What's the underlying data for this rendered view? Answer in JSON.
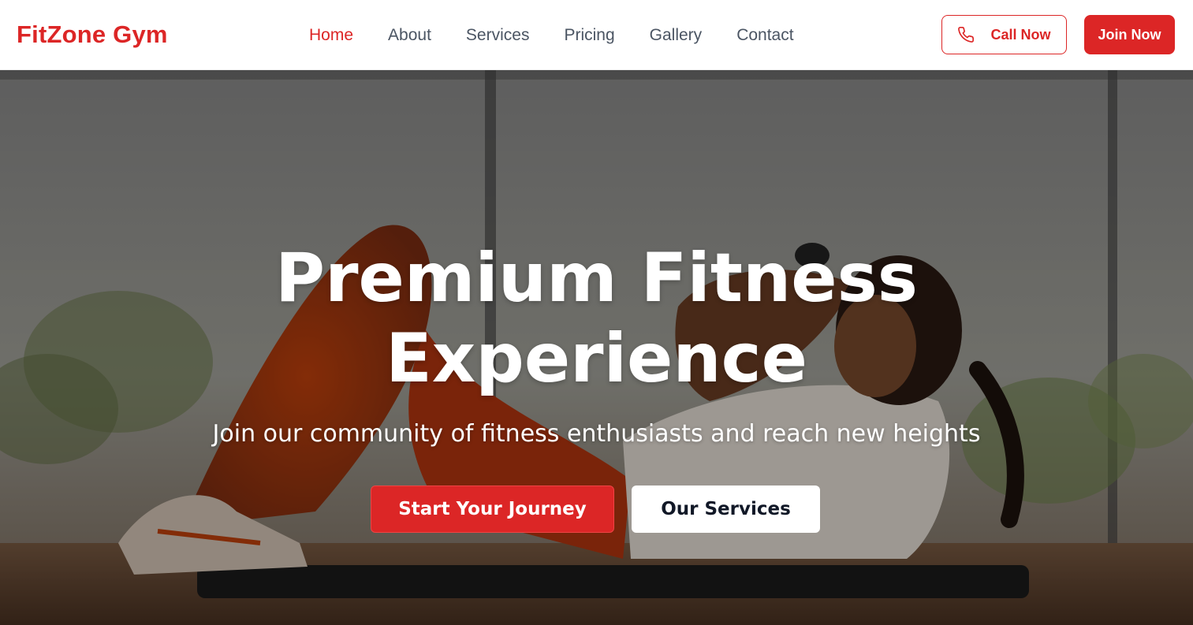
{
  "brand": {
    "name": "FitZone Gym",
    "accent": "#dc2626"
  },
  "nav": {
    "items": [
      {
        "label": "Home",
        "active": true
      },
      {
        "label": "About",
        "active": false
      },
      {
        "label": "Services",
        "active": false
      },
      {
        "label": "Pricing",
        "active": false
      },
      {
        "label": "Gallery",
        "active": false
      },
      {
        "label": "Contact",
        "active": false
      }
    ]
  },
  "header_actions": {
    "call_label": "Call Now",
    "call_icon": "phone-icon",
    "join_label": "Join Now"
  },
  "hero": {
    "title_line1": "Premium Fitness",
    "title_line2": "Experience",
    "subtitle": "Join our community of fitness enthusiasts and reach new heights",
    "primary_cta": "Start Your Journey",
    "secondary_cta": "Our Services",
    "background_image": "woman-doing-crunches-on-mat"
  }
}
